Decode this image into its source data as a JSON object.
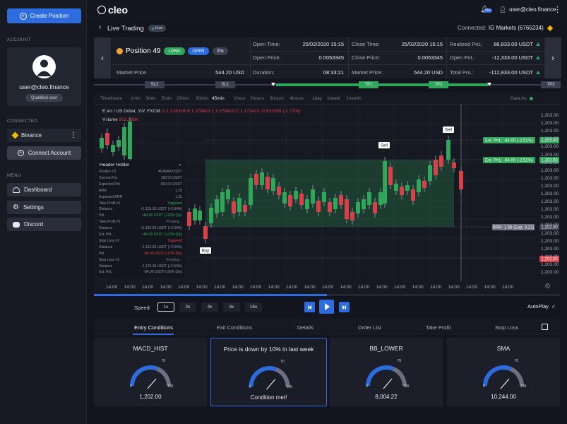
{
  "sidebar": {
    "create_label": "Create Position",
    "account_heading": "ACCOUNT",
    "user_email": "user@cleo.finance",
    "user_badge": "Qualified user",
    "connected_heading": "CONNECTED",
    "exchange_name": "Binance",
    "connect_label": "Connect Account",
    "menu_heading": "MENU",
    "menu": [
      "Dashboard",
      "Settings",
      "Discord"
    ]
  },
  "topbar": {
    "logo": "cleo",
    "notif_count": "99+",
    "user_email": "user@cleo.finance"
  },
  "live": {
    "title": "Live Trading",
    "badge": "Live",
    "connected_label": "Connected:",
    "connected_value": "IG Markets (6765234)"
  },
  "position": {
    "name": "Position 49",
    "pill_long": "LONG",
    "pill_open": "OPEN",
    "pill_lev": "20x",
    "market_price_label": "Market Price",
    "market_price_value": "544.20 USD",
    "open_time_label": "Open Time:",
    "open_time_value": "25/02/2020 15:15",
    "open_price_label": "Open Price:",
    "open_price_value": "0.0053345",
    "duration_label": "Duration:",
    "duration_value": "08:33:21",
    "close_time_label": "Close Time:",
    "close_time_value": "25/02/2020 15:15",
    "close_price_label": "Close Price:",
    "close_price_value": "0.0053345",
    "market_price2_label": "Market Price:",
    "market_price2_value": "544.20 USD",
    "realized_label": "Realized PnL:",
    "realized_value": "88,833.00 USDT",
    "open_pnl_label": "Open PnL:",
    "open_pnl_value": "-12,333.00 USDT",
    "total_pnl_label": "Total PnL:",
    "total_pnl_value": "-112,833.00 USDT"
  },
  "levels": [
    "SL2",
    "SL1",
    "TP1",
    "TP2",
    "TP3"
  ],
  "timeframes": [
    "Timeframe",
    "1min",
    "3min",
    "5min",
    "15min",
    "30min",
    "45min",
    "1hour",
    "2hours",
    "3hours",
    "4hours",
    "1day",
    "1week",
    "1month"
  ],
  "data_label": "Data Av.",
  "chart_info": {
    "symbol": "Euro / US Dollar, 1W, FXCM",
    "o": "O 1.174328",
    "h": "H 1.178423",
    "l": "L 1.178423",
    "c": "C 1.178423",
    "chg": "-0.522355 (-1.17%)",
    "volume_label": "Volume",
    "volume_value": "902.366K"
  },
  "chart_data": {
    "type": "candlestick",
    "y_ticks": [
      "1,203.00",
      "1,203.00",
      "1,203.00",
      "1,203.00",
      "1,203.00",
      "1,203.00",
      "1,203.00",
      "1,203.00",
      "1,203.00",
      "1,203.00",
      "1,203.00",
      "1,203.00",
      "1,203.00",
      "1,203.00",
      "1,203.00",
      "1,203.00",
      "1,203.00",
      "1,203.00",
      "1,203.00",
      "1,203.00",
      "1,203.00"
    ],
    "x_ticks": [
      "14:00",
      "14:00",
      "14:00",
      "14:00",
      "14:00",
      "14:00",
      "14:00",
      "14:00",
      "14:00",
      "14:00",
      "14:00",
      "14:00",
      "14:00",
      "14:00",
      "14:00",
      "14:00",
      "14:00",
      "14:00",
      "14:00",
      "14:00",
      "14:00",
      "14:00",
      "14:00"
    ],
    "price_tags": [
      "1,203.00",
      "1,203.00",
      "1,203.00",
      "1,203.00"
    ],
    "annotations": {
      "buy": "Buy",
      "sell1": "Sell",
      "sell2": "Sell",
      "est1": "Est. PnL: -84.00 (-2.51%)",
      "est2": "Est. PnL: -84.00 (-2.51%)",
      "rrr": "RRR: 1.56 (Exp. 3.21)"
    }
  },
  "holder": {
    "title": "Header Holder",
    "rows": [
      [
        "Position ID",
        "49 AVAX/USDT",
        "dim"
      ],
      [
        "Current PnL",
        "152.00 USDT",
        "dim"
      ],
      [
        "Expected PnL",
        "660.00 USDT",
        "dim"
      ],
      [
        "RRR",
        "1.25",
        "dim"
      ],
      [
        "Expected RRR",
        "1.25",
        "dim"
      ],
      [
        "Take Profit #1",
        "Triggered",
        "g"
      ],
      [
        "Distance",
        "+1,123.00 USDT (+2.54%)",
        "dim"
      ],
      [
        "PnL",
        "+84.00 USDT (+20% Qty)",
        "g"
      ],
      [
        "Take Profit #1",
        "Pending...",
        "pend"
      ],
      [
        "Distance",
        "+1,123.00 USDT (+2.54%)",
        "dim"
      ],
      [
        "Est. PnL",
        "+84.00 USDT (+20% Qty)",
        "g"
      ],
      [
        "Stop Loss #1",
        "Triggered",
        "r"
      ],
      [
        "Distance",
        "-1,123.00 USDT (+2.54%)",
        "dim"
      ],
      [
        "PnL",
        "-84.00 USDT (-20% Qty)",
        "r"
      ],
      [
        "Stop Loss #1",
        "Pending...",
        "pend"
      ],
      [
        "Distance",
        "-1,123.00 USDT (+2.54%)",
        "dim"
      ],
      [
        "Est. PnL",
        "-84.00 USDT (-20% Qty)",
        "dim"
      ]
    ]
  },
  "playback": {
    "speed_label": "Speed:",
    "speeds": [
      "1x",
      "2x",
      "4x",
      "8x",
      "16x"
    ],
    "autoplay_label": "AutoPlay",
    "progress": 0.5
  },
  "tabs": [
    "Entry Conditions",
    "Exit Conditions",
    "Details",
    "Order List",
    "Take Profit",
    "Stop Loss"
  ],
  "conditions": [
    {
      "title": "MACD_HIST",
      "value": "1,202.00",
      "gauge": 0.62
    },
    {
      "title": "Price is down by 10% in last week",
      "value": "Condition met!",
      "gauge": 0.62
    },
    {
      "title": "BB_LOWER",
      "value": "8,004.22",
      "gauge": 0.62
    },
    {
      "title": "SMA",
      "value": "10,244.00",
      "gauge": 0.62
    }
  ],
  "gauge_labels": {
    "min": "0",
    "mid": "70",
    "max": "100"
  },
  "colors": {
    "accent": "#2d6cdf",
    "green": "#2fa65a",
    "red": "#d8414a",
    "bg": "#12151d"
  }
}
